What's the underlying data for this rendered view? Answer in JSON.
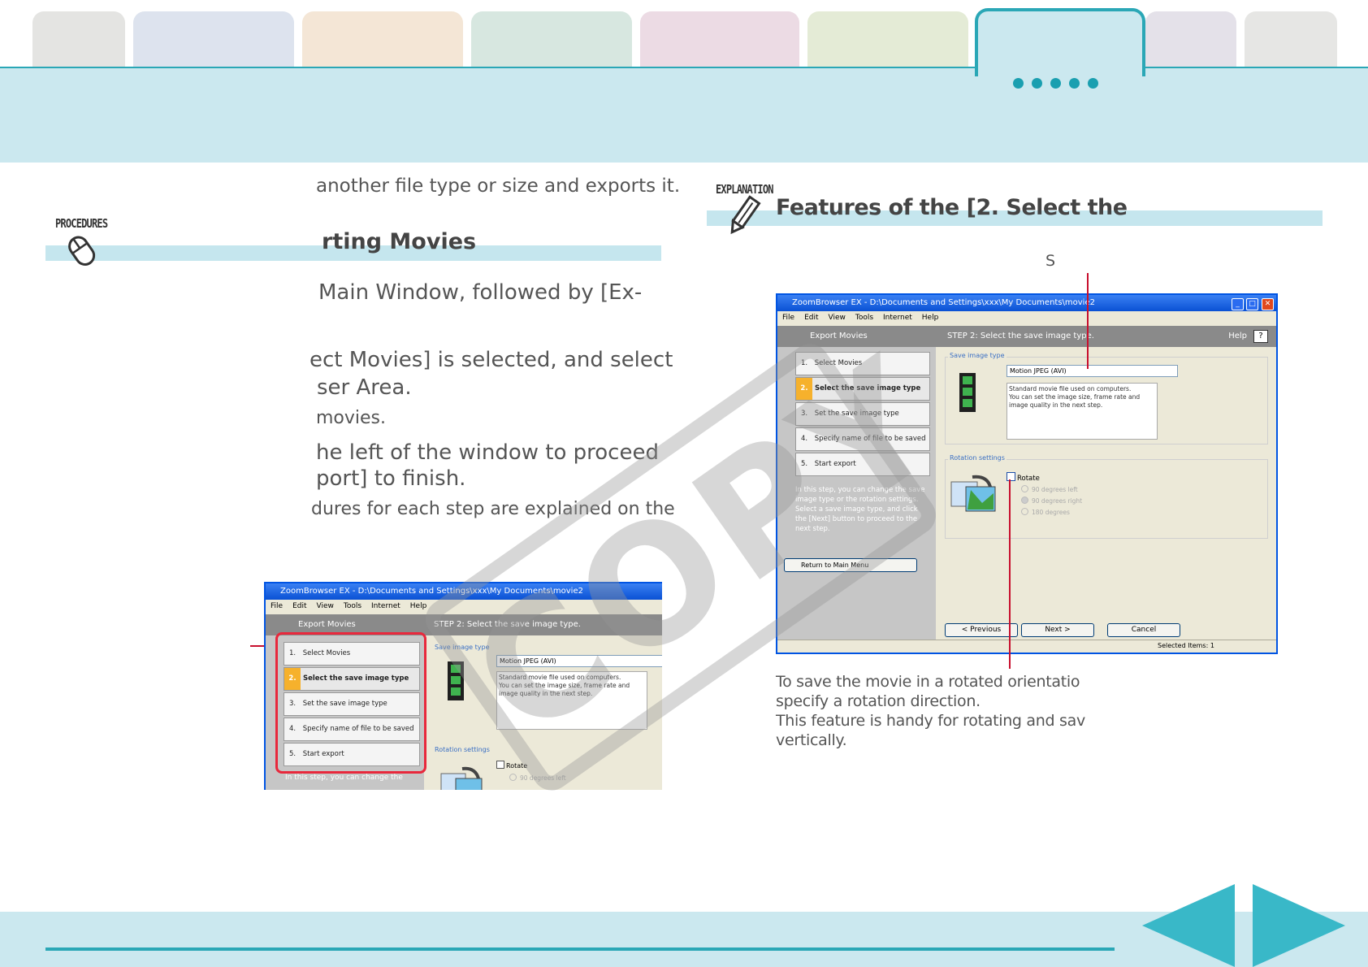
{
  "header": {
    "tab_colors": [
      "#e4e4e2",
      "#dde3ee",
      "#f4e6d6",
      "#d7e7e0",
      "#ecdbe4",
      "#e4ebd6",
      "#cbe8ef",
      "#e4e1e9",
      "#e6e6e4"
    ]
  },
  "procedures": {
    "badge": "PROCEDURES",
    "intro": "another file type or size and exports it.",
    "title": "rting Movies",
    "line1": "Main Window, followed by [Ex-",
    "line2a": "ect Movies] is selected, and select",
    "line2b": "ser Area.",
    "line2c": "movies.",
    "line3a": "he left of the window to proceed",
    "line3b": "port] to finish.",
    "line3c": "dures for each step are explained on the"
  },
  "explanation": {
    "badge": "EXPLANATION",
    "title": "Features of the [2. Select the",
    "callout_top": "S",
    "caption1": "To save the movie in a rotated orientatio",
    "caption2": "specify a rotation direction.",
    "caption3": "This feature is handy for rotating and sav",
    "caption4": "vertically."
  },
  "app": {
    "title": "ZoomBrowser EX  -  D:\\Documents and Settings\\xxx\\My Documents\\movie2",
    "menu": [
      "File",
      "Edit",
      "View",
      "Tools",
      "Internet",
      "Help"
    ],
    "panel_title": "Export Movies",
    "step_header": "STEP 2: Select the save image type.",
    "help": "Help",
    "help_btn": "?",
    "steps": [
      {
        "num": "1.",
        "label": "Select Movies"
      },
      {
        "num": "2.",
        "label": "Select the save image type"
      },
      {
        "num": "3.",
        "label": "Set the save image type"
      },
      {
        "num": "4.",
        "label": "Specify name of file to be saved"
      },
      {
        "num": "5.",
        "label": "Start export"
      }
    ],
    "hint": "In this step, you can change the save image type or the rotation settings.\nSelect a save image type, and click the [Next] button to proceed to the next step.",
    "hint_short": "In this step, you can change the",
    "return": "Return to Main Menu",
    "save_group": "Save image type",
    "save_value": "Motion JPEG (AVI)",
    "save_desc": "Standard movie file used on computers.\nYou can set the image size, frame rate and image quality in the next step.",
    "rotation_group": "Rotation settings",
    "rotate": "Rotate",
    "rotate_options": [
      "90 degrees left",
      "90 degrees right",
      "180 degrees"
    ],
    "prev": "< Previous",
    "next": "Next >",
    "cancel": "Cancel",
    "status": "Selected Items: 1"
  },
  "watermark": "COPY",
  "nav": {
    "prev_icon": "prev-arrow-icon",
    "next_icon": "next-arrow-icon"
  }
}
